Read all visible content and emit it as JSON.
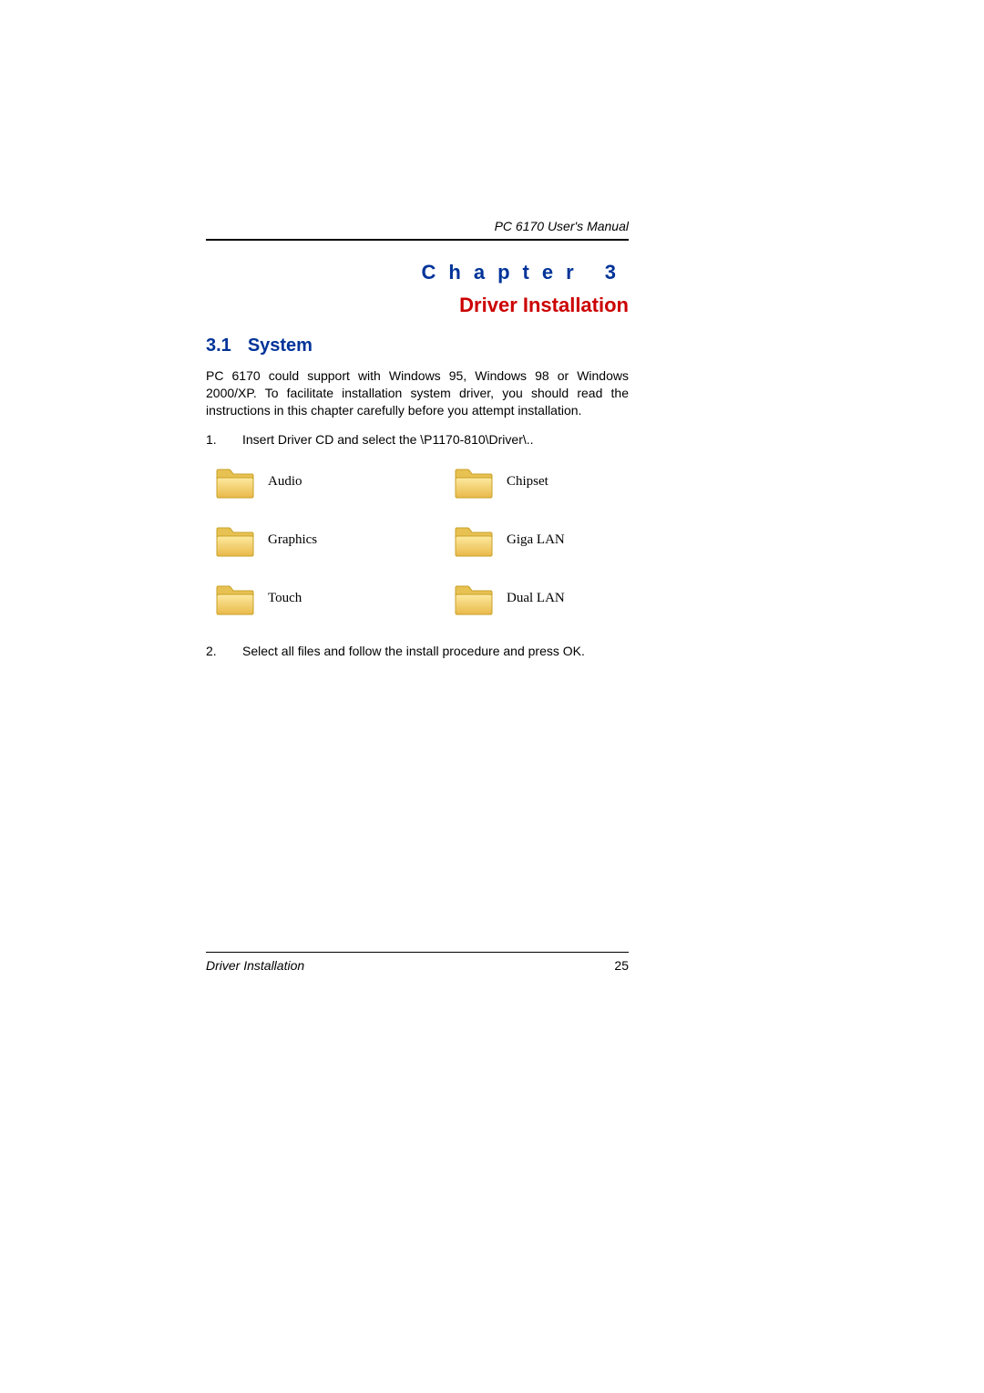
{
  "header": {
    "manual_title": "PC 6170 User's Manual"
  },
  "chapter": {
    "label": "Chapter 3",
    "title": "Driver Installation"
  },
  "section": {
    "number": "3.1",
    "title": "System"
  },
  "body": {
    "intro": "PC 6170 could support with Windows 95, Windows 98 or Windows 2000/XP. To facilitate installation system driver, you should read the instructions in this chapter carefully before you attempt installation."
  },
  "steps": [
    {
      "num": "1.",
      "text": "Insert Driver CD and select the \\P1170-810\\Driver\\.."
    },
    {
      "num": "2.",
      "text": "Select all files and follow the install procedure and press OK."
    }
  ],
  "folders": [
    {
      "label": "Audio"
    },
    {
      "label": "Chipset"
    },
    {
      "label": "Graphics"
    },
    {
      "label": "Giga LAN"
    },
    {
      "label": "Touch"
    },
    {
      "label": "Dual LAN"
    }
  ],
  "footer": {
    "left": "Driver Installation",
    "page": "25"
  }
}
